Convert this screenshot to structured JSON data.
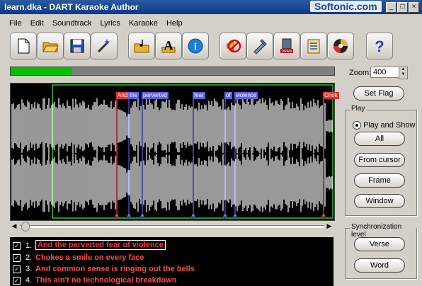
{
  "window": {
    "title": "learn.dka - DART Karaoke Author",
    "brand": "Softonic.com"
  },
  "menu": [
    "File",
    "Edit",
    "Soundtrack",
    "Lyrics",
    "Karaoke",
    "Help"
  ],
  "toolbar": [
    {
      "name": "new-icon"
    },
    {
      "name": "open-icon"
    },
    {
      "name": "save-icon"
    },
    {
      "name": "wizard-icon"
    },
    {
      "name": "open-soundtrack-icon"
    },
    {
      "name": "lyrics-font-icon"
    },
    {
      "name": "info-icon"
    },
    {
      "name": "no-sound-icon"
    },
    {
      "name": "edit-tool-icon"
    },
    {
      "name": "draw-icon"
    },
    {
      "name": "checklist-icon"
    },
    {
      "name": "audio-cd-icon"
    },
    {
      "name": "help-icon"
    }
  ],
  "progress": {
    "value": 0.19
  },
  "waveform": {
    "flags": [
      "And",
      "the",
      "perverted",
      "fear",
      "of",
      "violence",
      "Chok"
    ]
  },
  "zoom": {
    "label": "Zoom:",
    "value": "400"
  },
  "buttons": {
    "set_flag": "Set Flag"
  },
  "play_group": {
    "label": "Play",
    "option": "Play and Show",
    "all": "All",
    "from_cursor": "From cursor",
    "frame": "Frame",
    "window": "Window"
  },
  "sync_group": {
    "label": "Synchronization level",
    "verse": "Verse",
    "word": "Word"
  },
  "lyrics": [
    {
      "num": "1.",
      "text": "And the perverted fear of violence"
    },
    {
      "num": "2.",
      "text": "Chokes a smile on every face"
    },
    {
      "num": "3.",
      "text": "And common sense is ringing out the bells"
    },
    {
      "num": "4.",
      "text": "This ain't no technological breakdown"
    }
  ]
}
